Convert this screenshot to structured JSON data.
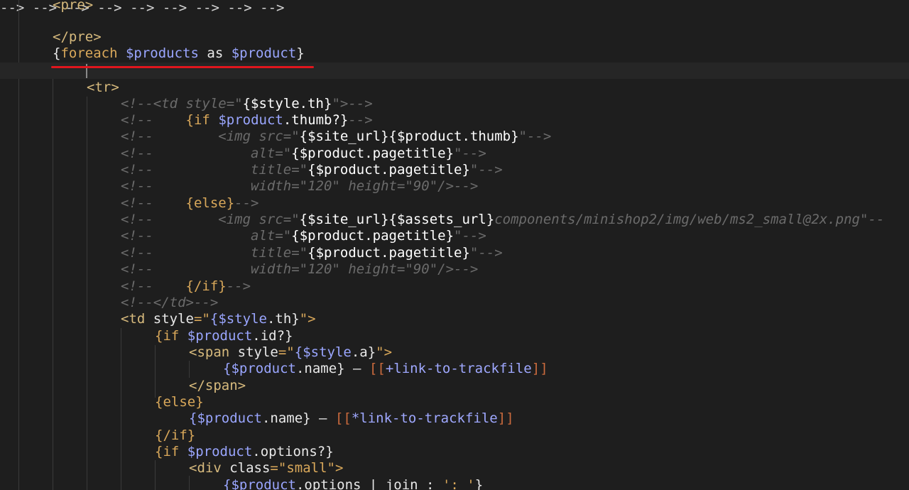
{
  "code": {
    "pre_open": "<pre>",
    "pre_close": "</pre>",
    "foreach": {
      "open": "{",
      "keyword": "foreach",
      "collection": "$products",
      "as": "as",
      "item": "$product",
      "close": "}"
    },
    "tr_open": "<tr>",
    "comment_lines": [
      "<!--<td style=\"",
      "{$style.th}",
      "\">-->"
    ],
    "c_if_thumb": [
      "<!--",
      "{if",
      "$product",
      ".thumb?}",
      "-->"
    ],
    "c_img1": [
      "<!--",
      "<img src=\"",
      "{$site_url}",
      "{$product",
      ".thumb}",
      "\"-->"
    ],
    "c_alt1": [
      "<!--",
      "alt=\"",
      "{$product",
      ".pagetitle}",
      "\"-->"
    ],
    "c_title1": [
      "<!--",
      "title=\"",
      "{$product",
      ".pagetitle}",
      "\"-->"
    ],
    "c_size1": [
      "<!--",
      "width=\"120\" height=\"90\"/>-->"
    ],
    "c_else": [
      "<!--",
      "{else}",
      "-->"
    ],
    "c_img2": [
      "<!--",
      "<img src=\"",
      "{$site_url}",
      "{$assets_url}",
      "components/minishop2/img/web/ms2_small@2x.png\"--"
    ],
    "c_alt2": [
      "<!--",
      "alt=\"",
      "{$product",
      ".pagetitle}",
      "\"-->"
    ],
    "c_title2": [
      "<!--",
      "title=\"",
      "{$product",
      ".pagetitle}",
      "\"-->"
    ],
    "c_size2": [
      "<!--",
      "width=\"120\" height=\"90\"/>-->"
    ],
    "c_endif": [
      "<!--",
      "{/if}",
      "-->"
    ],
    "c_td_close": "<!--</td>-->",
    "td_open": [
      "<td",
      "style",
      "=\"",
      "{$style",
      ".th}",
      "\">"
    ],
    "if_id": [
      "{if",
      "$product",
      ".id?}"
    ],
    "span_open": [
      "<span",
      "style",
      "=\"",
      "{$style",
      ".a}",
      "\">"
    ],
    "name_line1": [
      "{$product",
      ".name}",
      "–",
      "[[",
      "+link-to-trackfile",
      "]]"
    ],
    "span_close": "</span>",
    "else": "{else}",
    "name_line2": [
      "{$product",
      ".name}",
      "–",
      "[[",
      "*link-to-trackfile",
      "]]"
    ],
    "endif": "{/if}",
    "if_options": [
      "{if",
      "$product",
      ".options?}"
    ],
    "div_open": [
      "<div",
      "class",
      "=\"",
      "small",
      "\">"
    ],
    "options_line": [
      "{$product",
      ".options",
      "|",
      "join",
      ":",
      "': '",
      "}"
    ]
  },
  "colors": {
    "background": "#1e1e1e",
    "underline": "#e0161d"
  }
}
